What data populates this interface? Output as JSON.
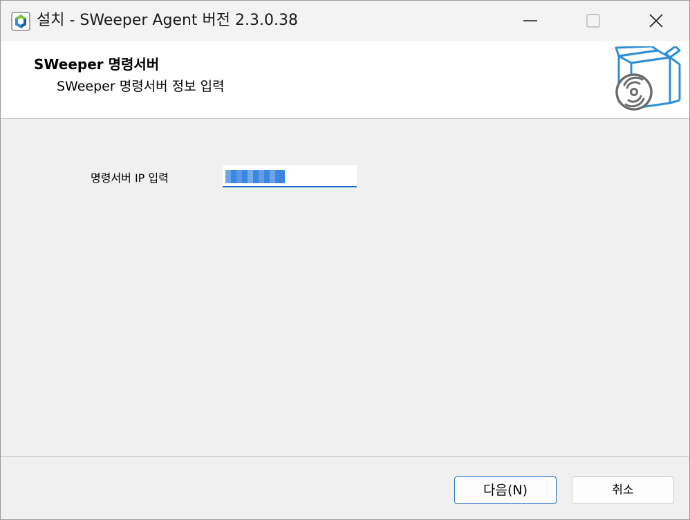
{
  "window": {
    "title": "설치 - SWeeper Agent 버전 2.3.0.38",
    "controls": [
      "minimize",
      "maximize",
      "close"
    ]
  },
  "banner": {
    "title": "SWeeper 명령서버",
    "subtitle": "SWeeper 명령서버 정보 입력",
    "graphic": "box-with-disc-icon"
  },
  "form": {
    "ip_label": "명령서버 IP 입력",
    "ip_value": ""
  },
  "footer": {
    "next_label": "다음(N)",
    "cancel_label": "취소"
  },
  "colors": {
    "accent": "#1e6fc9",
    "selection": "#3b86e0",
    "icon_blue": "#2f8fd6",
    "icon_gray": "#6b6b6b"
  }
}
